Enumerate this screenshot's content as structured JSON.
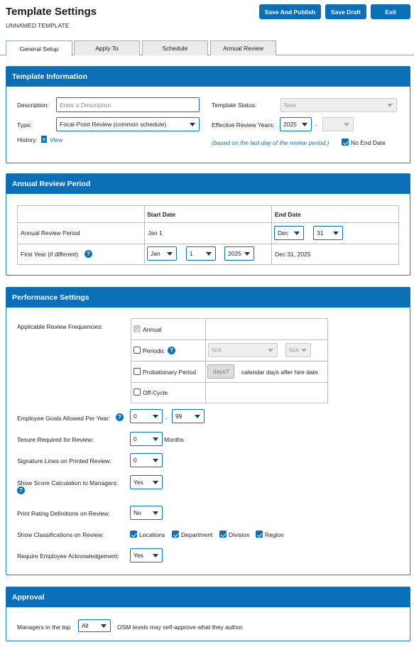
{
  "header": {
    "title": "Template Settings",
    "subtitle": "UNNAMED TEMPLATE",
    "save_publish": "Save And Publish",
    "save_draft": "Save Draft",
    "exit": "Exit"
  },
  "tabs": [
    "General Setup",
    "Apply To",
    "Schedule",
    "Annual Review"
  ],
  "template_info": {
    "heading": "Template Information",
    "description_label": "Description:",
    "description_placeholder": "Enter a Description",
    "type_label": "Type:",
    "type_value": "Focal-Point Review (common schedule)",
    "history_label": "History:",
    "history_link": "View",
    "status_label": "Template Status:",
    "status_value": "New",
    "eff_years_label": "Effective Review Years:",
    "eff_year_start": "2025",
    "eff_year_sep": "-",
    "eff_year_end": "",
    "note": "(based on the last day of the review period.)",
    "no_end_date": "No End Date",
    "no_end_date_checked": true
  },
  "annual_period": {
    "heading": "Annual Review Period",
    "col_start": "Start Date",
    "col_end": "End Date",
    "row1_label": "Annual Review Period",
    "row1_start": "Jan 1",
    "row1_end_month": "Dec",
    "row1_end_day": "31",
    "row2_label": "First Year (if different)",
    "row2_month": "Jan",
    "row2_day": "1",
    "row2_year": "2025",
    "row2_end": "Dec 31, 2025"
  },
  "performance": {
    "heading": "Performance Settings",
    "freq_label": "Applicable Review Frequencies:",
    "annual": "Annual",
    "periodic": "Periodic",
    "periodic_sel1": "N/A",
    "periodic_sel2": "N/A",
    "probationary": "Probationary Period",
    "days_placeholder": "days?",
    "days_suffix": "calendar days after hire date.",
    "offcycle": "Off-Cycle",
    "goals_label": "Employee Goals Allowed Per Year:",
    "goals_min": "0",
    "goals_sep": "-",
    "goals_max": "99",
    "tenure_label": "Tenure Required for Review:",
    "tenure_value": "0",
    "tenure_unit": "Months",
    "sig_label": "Signature Lines on Printed Review:",
    "sig_value": "0",
    "score_label": "Show Score Calculation to Managers:",
    "score_value": "Yes",
    "print_label": "Print Rating Definitions on Review:",
    "print_value": "No",
    "class_label": "Show Classifications on Review:",
    "class_items": [
      "Locations",
      "Department",
      "Division",
      "Region"
    ],
    "ack_label": "Require Employee Acknowledgement:",
    "ack_value": "Yes"
  },
  "approval": {
    "heading": "Approval",
    "prefix": "Managers in the top",
    "value": "All",
    "suffix": "OSM levels may self-approve what they author."
  }
}
